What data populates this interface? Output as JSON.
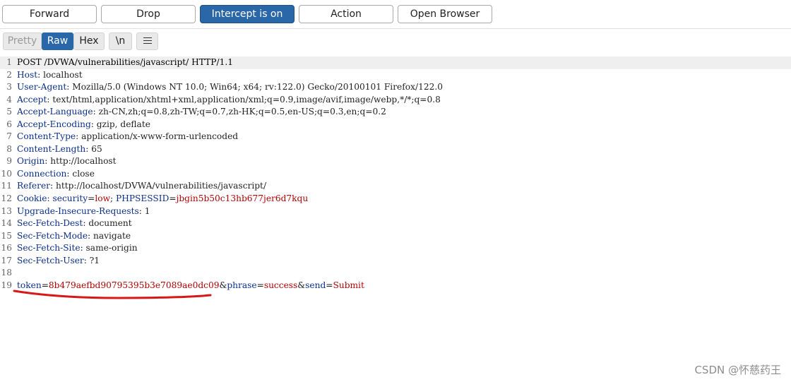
{
  "toolbar": {
    "buttons": [
      {
        "label": "Forward"
      },
      {
        "label": "Drop"
      },
      {
        "label": "Intercept is on"
      },
      {
        "label": "Action"
      },
      {
        "label": "Open Browser"
      }
    ]
  },
  "view_tabs": {
    "pretty": "Pretty",
    "raw": "Raw",
    "hex": "Hex",
    "newline": "\\n",
    "menu_icon": "hamburger-menu-icon"
  },
  "request": {
    "request_line": "POST /DVWA/vulnerabilities/javascript/ HTTP/1.1",
    "headers": [
      {
        "num": "2",
        "name": "Host",
        "value": "localhost"
      },
      {
        "num": "3",
        "name": "User-Agent",
        "value": "Mozilla/5.0 (Windows NT 10.0; Win64; x64; rv:122.0) Gecko/20100101 Firefox/122.0"
      },
      {
        "num": "4",
        "name": "Accept",
        "value": "text/html,application/xhtml+xml,application/xml;q=0.9,image/avif,image/webp,*/*;q=0.8"
      },
      {
        "num": "5",
        "name": "Accept-Language",
        "value": "zh-CN,zh;q=0.8,zh-TW;q=0.7,zh-HK;q=0.5,en-US;q=0.3,en;q=0.2"
      },
      {
        "num": "6",
        "name": "Accept-Encoding",
        "value": "gzip, deflate"
      },
      {
        "num": "7",
        "name": "Content-Type",
        "value": "application/x-www-form-urlencoded"
      },
      {
        "num": "8",
        "name": "Content-Length",
        "value": "65"
      },
      {
        "num": "9",
        "name": "Origin",
        "value": "http://localhost"
      },
      {
        "num": "10",
        "name": "Connection",
        "value": "close"
      },
      {
        "num": "11",
        "name": "Referer",
        "value": "http://localhost/DVWA/vulnerabilities/javascript/"
      }
    ],
    "cookie": {
      "num": "12",
      "name": "Cookie",
      "security_name": "security",
      "security_value": "low",
      "sess_name": "PHPSESSID",
      "sess_value": "jbgin5b50c13hb677jer6d7kqu"
    },
    "headers_after": [
      {
        "num": "13",
        "name": "Upgrade-Insecure-Requests",
        "value": "1"
      },
      {
        "num": "14",
        "name": "Sec-Fetch-Dest",
        "value": "document"
      },
      {
        "num": "15",
        "name": "Sec-Fetch-Mode",
        "value": "navigate"
      },
      {
        "num": "16",
        "name": "Sec-Fetch-Site",
        "value": "same-origin"
      },
      {
        "num": "17",
        "name": "Sec-Fetch-User",
        "value": "?1"
      }
    ],
    "body": {
      "token_name": "token",
      "token_value": "8b479aefbd90795395b3e7089ae0dc09",
      "phrase_name": "phrase",
      "phrase_value": "success",
      "send_name": "send",
      "send_value": "Submit"
    }
  },
  "annotation_color": "#d81818",
  "watermark": "CSDN @怀慈药王"
}
